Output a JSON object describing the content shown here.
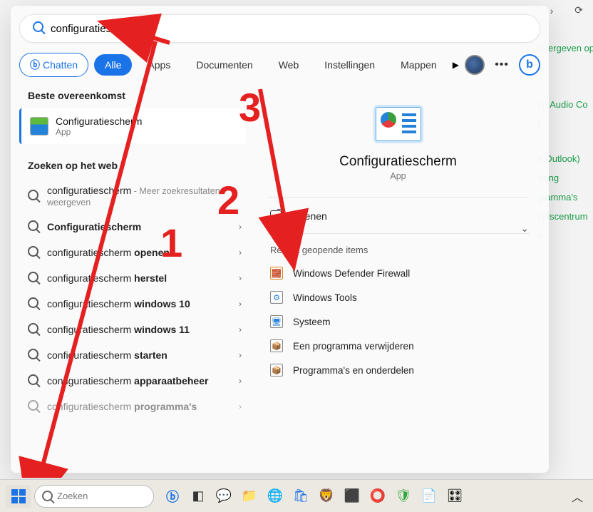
{
  "search": {
    "value": "configuratiescherm"
  },
  "tabs": {
    "chat": "Chatten",
    "all": "Alle",
    "apps": "Apps",
    "docs": "Documenten",
    "web": "Web",
    "settings": "Instellingen",
    "folders": "Mappen"
  },
  "left": {
    "best_match_heading": "Beste overeenkomst",
    "best_match": {
      "title": "Configuratiescherm",
      "sub": "App"
    },
    "web_heading": "Zoeken op het web",
    "web_first": {
      "text": "configuratiescherm",
      "hint": " - Meer zoekresultaten weergeven"
    },
    "items": [
      {
        "prefix": "",
        "bold": "Configuratiescherm",
        "suffix": ""
      },
      {
        "prefix": "configuratiescherm ",
        "bold": "openen",
        "suffix": ""
      },
      {
        "prefix": "configuratiescherm ",
        "bold": "herstel",
        "suffix": ""
      },
      {
        "prefix": "configuratiescherm ",
        "bold": "windows 10",
        "suffix": ""
      },
      {
        "prefix": "configuratiescherm ",
        "bold": "windows 11",
        "suffix": ""
      },
      {
        "prefix": "configuratiescherm ",
        "bold": "starten",
        "suffix": ""
      },
      {
        "prefix": "configuratiescherm ",
        "bold": "apparaatbeheer",
        "suffix": ""
      },
      {
        "prefix": "configuratiescherm ",
        "bold": "programma's",
        "suffix": ""
      }
    ]
  },
  "right": {
    "title": "Configuratiescherm",
    "sub": "App",
    "open": "Openen",
    "recent_heading": "Recent geopende items",
    "recent": [
      "Windows Defender Firewall",
      "Windows Tools",
      "Systeem",
      "Een programma verwijderen",
      "Programma's en onderdelen"
    ]
  },
  "annotations": {
    "n1": "1",
    "n2": "2",
    "n3": "3"
  },
  "taskbar": {
    "search_placeholder": "Zoeken"
  },
  "background": {
    "display_label": "Veergeven op",
    "links": [
      "en Audio Co",
      "t",
      "ft Outlook)",
      "ssing",
      "gramma's",
      "eidscentrum",
      "s"
    ]
  }
}
